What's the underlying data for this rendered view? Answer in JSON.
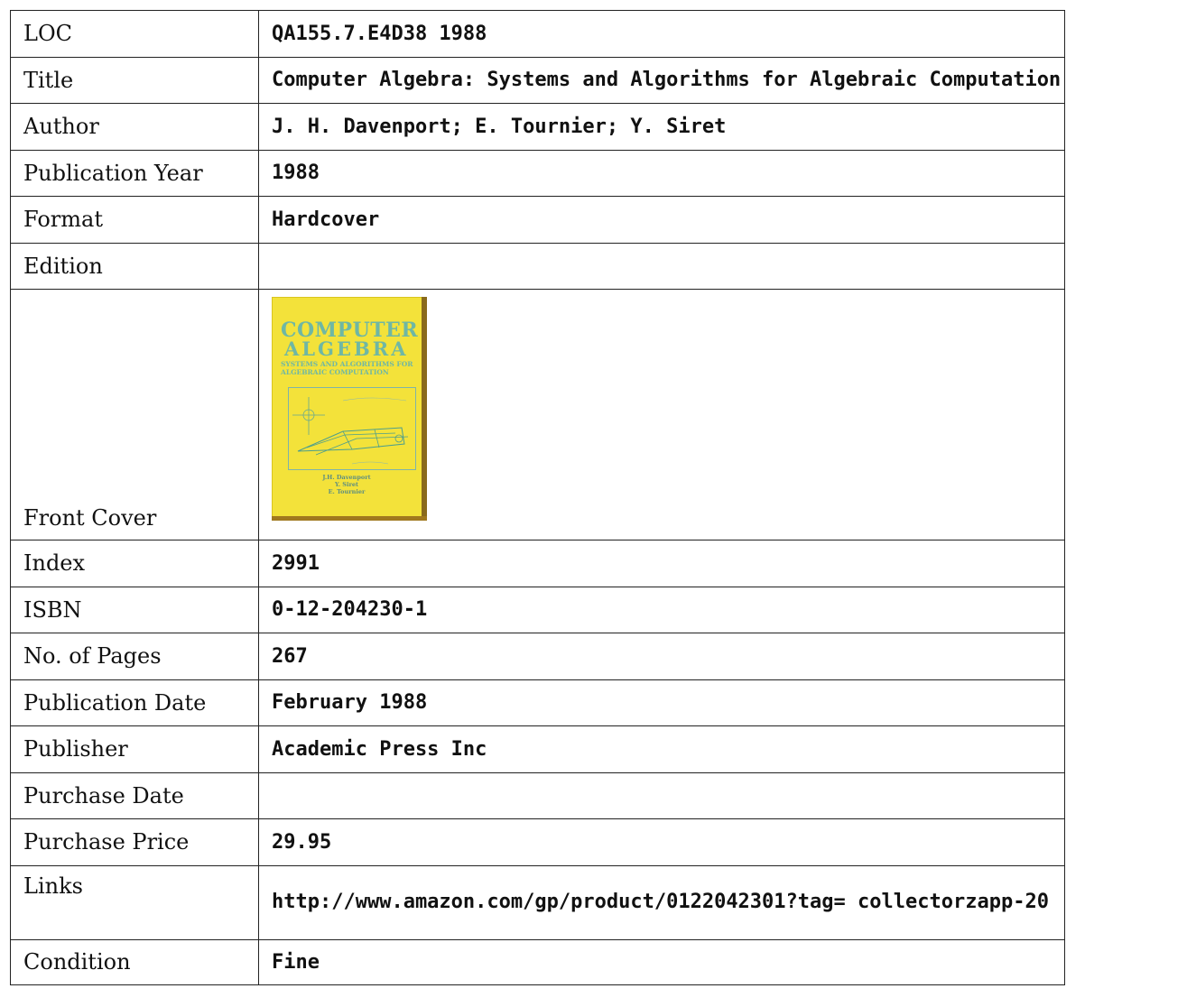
{
  "rows": [
    {
      "label": "LOC",
      "value": "QA155.7.E4D38 1988"
    },
    {
      "label": "Title",
      "value": "Computer Algebra: Systems and Algorithms for Algebraic Computation"
    },
    {
      "label": "Author",
      "value": "J. H. Davenport; E. Tournier; Y. Siret"
    },
    {
      "label": "Publication Year",
      "value": "1988"
    },
    {
      "label": "Format",
      "value": "Hardcover"
    },
    {
      "label": "Edition",
      "value": ""
    },
    {
      "label": "Front Cover",
      "value": ""
    },
    {
      "label": "Index",
      "value": "2991"
    },
    {
      "label": "ISBN",
      "value": "0-12-204230-1"
    },
    {
      "label": "No. of Pages",
      "value": "267"
    },
    {
      "label": "Publication Date",
      "value": "February 1988"
    },
    {
      "label": "Publisher",
      "value": "Academic Press Inc"
    },
    {
      "label": "Purchase Date",
      "value": ""
    },
    {
      "label": "Purchase Price",
      "value": "29.95"
    },
    {
      "label": "Links",
      "value": "http://www.amazon.com/gp/product/0122042301?tag= collectorzapp-20"
    },
    {
      "label": "Condition",
      "value": "Fine"
    }
  ],
  "cover": {
    "title_line1": "COMPUTER",
    "title_line2": "ALGEBRA",
    "subtitle": "SYSTEMS AND ALGORITHMS FOR ALGEBRAIC COMPUTATION",
    "authors": [
      "J.H. Davenport",
      "Y. Siret",
      "E. Tournier"
    ],
    "background_color": "#f3e23a",
    "text_color": "#6fb7a4"
  }
}
